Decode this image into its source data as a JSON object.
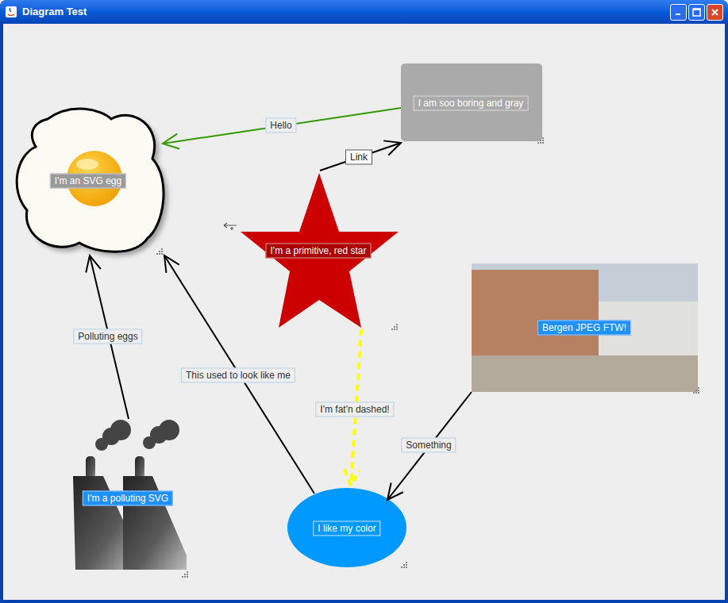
{
  "window": {
    "title": "Diagram Test"
  },
  "nodes": [
    {
      "label": "I'm an SVG egg",
      "kind": "egg",
      "color": "#fbfbf4"
    },
    {
      "label": "I am soo boring and gray",
      "kind": "box",
      "color": "#aaaaaa"
    },
    {
      "label": "I'm a primitive, red star",
      "kind": "star",
      "color": "#cc0000"
    },
    {
      "label": "Bergen JPEG FTW!",
      "kind": "photo",
      "color": "#c5cdd6"
    },
    {
      "label": "I'm a polluting SVG",
      "kind": "factory",
      "color": "#5a5a5a"
    },
    {
      "label": "I like my color",
      "kind": "ellipse",
      "color": "#0099ff"
    }
  ],
  "edges": [
    {
      "label": "Hello",
      "color": "#339900",
      "dashed": false
    },
    {
      "label": "Link",
      "color": "#000000",
      "dashed": false
    },
    {
      "label": "Polluting eggs",
      "color": "#000000",
      "dashed": false
    },
    {
      "label": "This used to look like me",
      "color": "#000000",
      "dashed": false
    },
    {
      "label": "I'm fat'n dashed!",
      "color": "#ffff00",
      "dashed": true
    },
    {
      "label": "Something",
      "color": "#000000",
      "dashed": false
    }
  ]
}
